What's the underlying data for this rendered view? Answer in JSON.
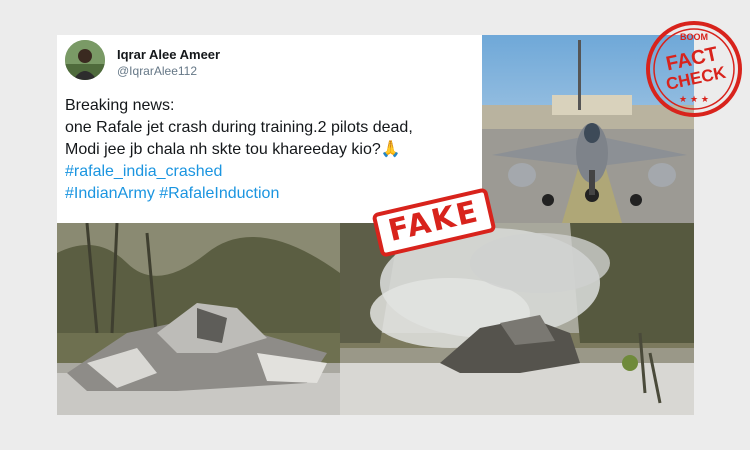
{
  "tweet": {
    "author_name": "Iqrar Alee Ameer",
    "author_handle": "@IqrarAlee112",
    "text_lines": [
      "Breaking news:",
      "one Rafale jet crash during training.2 pilots dead,",
      "Modi jee jb chala nh skte tou khareeday kio?"
    ],
    "emoji": "🙏",
    "hashtag_line_1": "#rafale_india_crashed",
    "hashtag_line_2": "#IndianArmy #RafaleInduction"
  },
  "stamps": {
    "fake_label": "FAKE",
    "factcheck_brand": "BOOM",
    "factcheck_word1": "FACT",
    "factcheck_word2": "CHECK",
    "factcheck_stars": "★ ★ ★"
  },
  "colors": {
    "stamp_red": "#d8231c",
    "hashtag_blue": "#1b95e0",
    "text_dark": "#14171a",
    "handle_gray": "#657786"
  },
  "icons": {
    "avatar": "profile-photo",
    "emoji": "folded-hands"
  }
}
